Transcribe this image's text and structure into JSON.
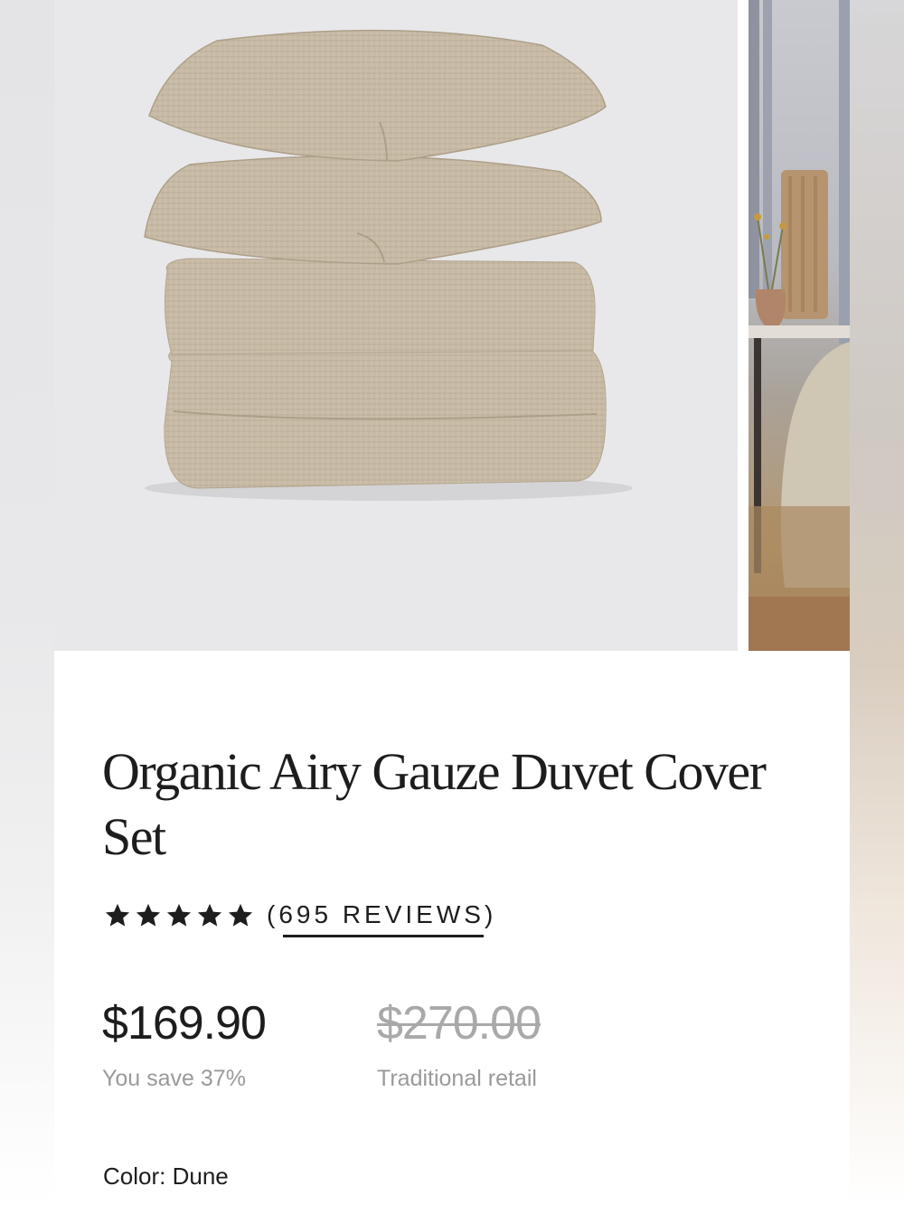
{
  "product": {
    "title": "Organic Airy Gauze Duvet Cover Set",
    "rating_stars": 5,
    "reviews_label": "(695 REVIEWS)",
    "price": "$169.90",
    "savings": "You save 37%",
    "original_price": "$270.00",
    "original_price_caption": "Traditional retail",
    "color_label": "Color: Dune"
  },
  "gallery": {
    "main_icon": "folded-duvet-pillows-image",
    "secondary_icon": "bedroom-scene-image"
  },
  "colors": {
    "text": "#1d1d1d",
    "muted": "#9a9a9a",
    "strike": "#a9a9a9",
    "fabric": "#c9bca7"
  }
}
